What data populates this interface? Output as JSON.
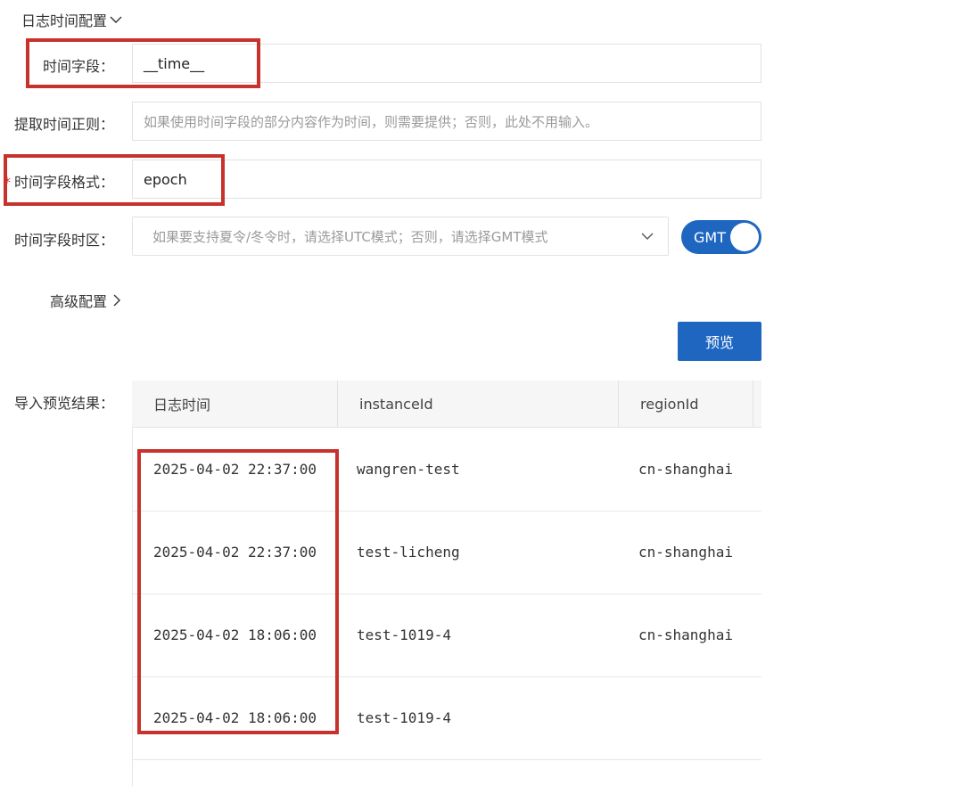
{
  "section": {
    "title": "日志时间配置",
    "chevron": "chevron-down-icon"
  },
  "fields": {
    "time_field": {
      "label": "时间字段：",
      "value": "__time__"
    },
    "extract_regex": {
      "label": "提取时间正则：",
      "placeholder": "如果使用时间字段的部分内容作为时间，则需要提供；否则，此处不用输入。"
    },
    "time_format": {
      "required_mark": "*",
      "label": "时间字段格式：",
      "value": "epoch"
    },
    "timezone": {
      "label": "时间字段时区：",
      "placeholder": "如果要支持夏令/冬令时，请选择UTC模式；否则，请选择GMT模式",
      "toggle_label": "GMT"
    }
  },
  "advanced": {
    "label": "高级配置",
    "chevron": "chevron-right-icon"
  },
  "preview_button": {
    "label": "预览"
  },
  "result": {
    "label": "导入预览结果：",
    "columns": [
      "日志时间",
      "instanceId",
      "regionId"
    ],
    "rows": [
      [
        "2025-04-02 22:37:00",
        "wangren-test",
        "cn-shanghai"
      ],
      [
        "2025-04-02 22:37:00",
        "test-licheng",
        "cn-shanghai"
      ],
      [
        "2025-04-02 18:06:00",
        "test-1019-4",
        "cn-shanghai"
      ],
      [
        "2025-04-02 18:06:00",
        "test-1019-4",
        ""
      ]
    ]
  },
  "colors": {
    "accent": "#1f66c1",
    "highlight": "#c8322c",
    "required": "#d9262c"
  }
}
